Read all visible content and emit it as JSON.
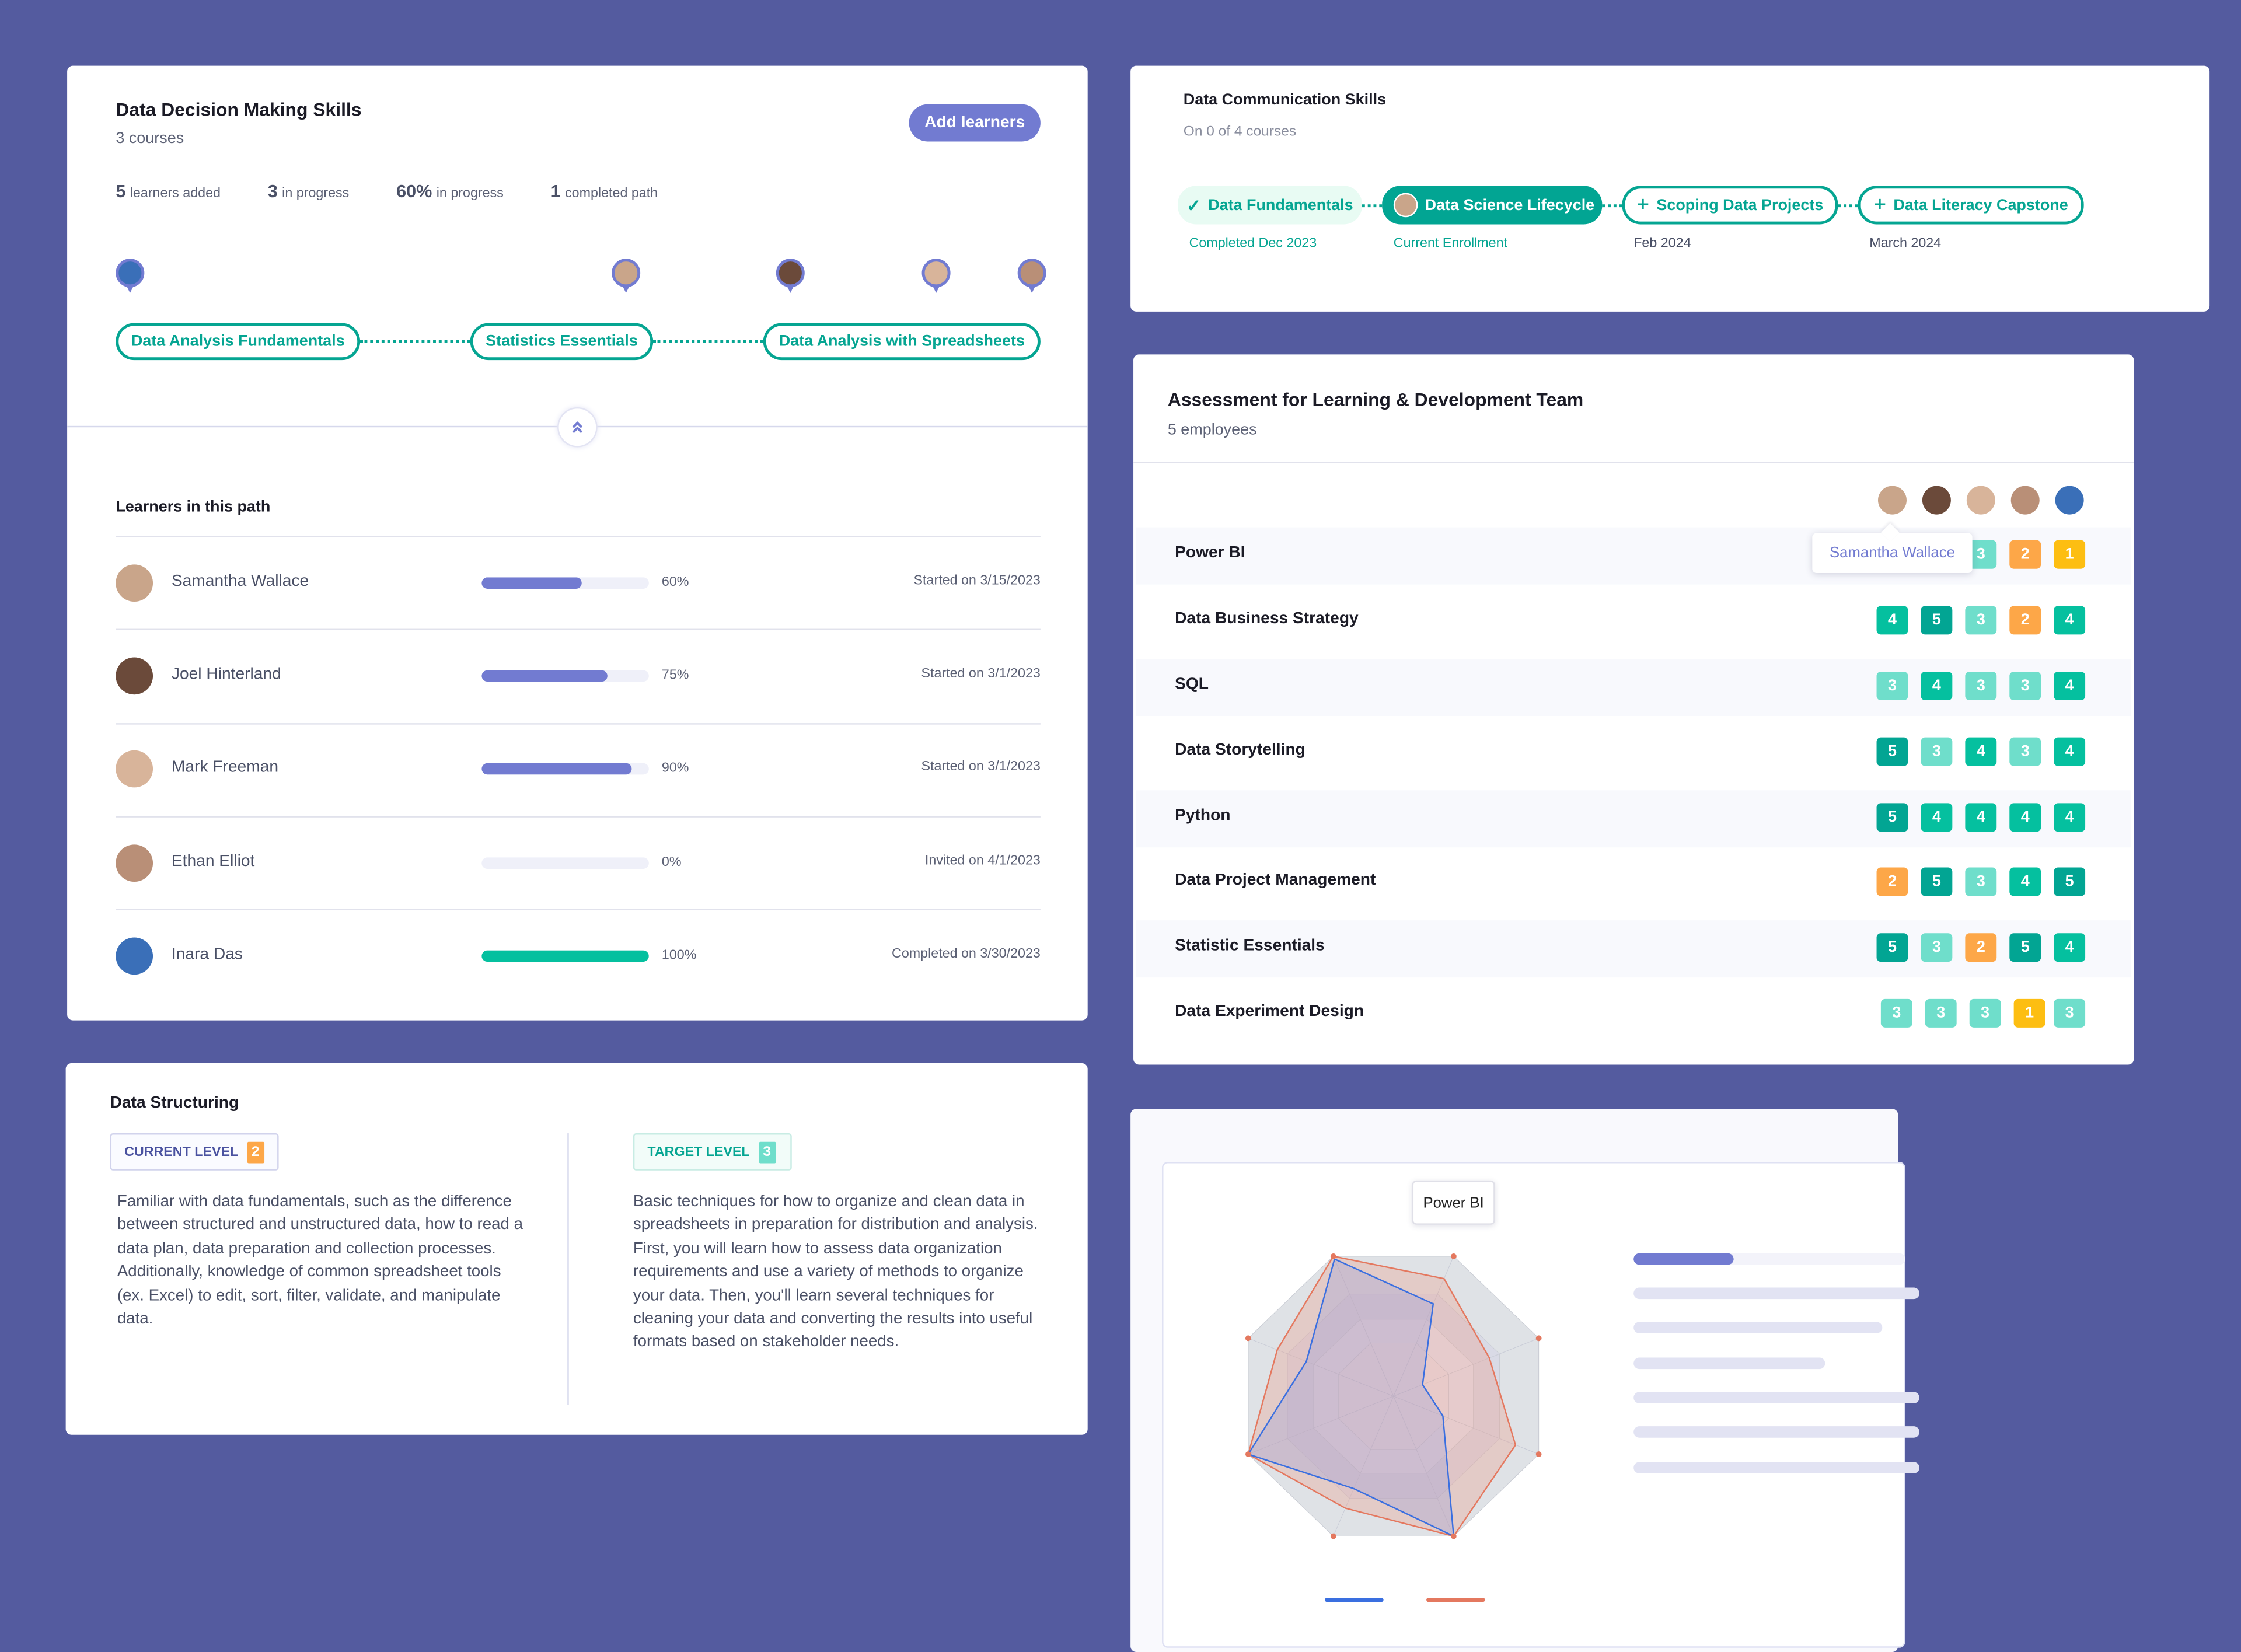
{
  "colors": {
    "background": "#545b9f",
    "accent": "#727bd1",
    "teal": "#05a592",
    "level5": "#02a593",
    "level4": "#05c09f",
    "level3": "#6fdecb",
    "level2": "#fda748",
    "level1": "#fdbe12"
  },
  "path_card": {
    "title": "Data Decision Making Skills",
    "subtitle": "3 courses",
    "add_button": "Add learners",
    "stats": [
      {
        "num": "5",
        "label": "learners added"
      },
      {
        "num": "3",
        "label": "in progress"
      },
      {
        "num": "60%",
        "label": "in progress"
      },
      {
        "num": "1",
        "label": "completed path"
      }
    ],
    "courses": [
      "Data Analysis Fundamentals",
      "Statistics Essentials",
      "Data Analysis with Spreadsheets"
    ],
    "collapse_icon": "chevrons-up-icon",
    "learners_heading": "Learners in this path",
    "learners": [
      {
        "name": "Samantha Wallace",
        "progress": 60,
        "pct": "60%",
        "status": "Started on 3/15/2023"
      },
      {
        "name": "Joel Hinterland",
        "progress": 75,
        "pct": "75%",
        "status": "Started on 3/1/2023"
      },
      {
        "name": "Mark Freeman",
        "progress": 90,
        "pct": "90%",
        "status": "Started on 3/1/2023"
      },
      {
        "name": "Ethan Elliot",
        "progress": 0,
        "pct": "0%",
        "status": "Invited on 4/1/2023"
      },
      {
        "name": "Inara Das",
        "progress": 100,
        "pct": "100%",
        "status": "Completed on 3/30/2023"
      }
    ]
  },
  "comm_card": {
    "title": "Data Communication Skills",
    "subtitle": "On 0 of 4 courses",
    "steps": [
      {
        "label": "Data Fundamentals",
        "caption": "Completed Dec 2023",
        "state": "completed",
        "icon": "check-icon"
      },
      {
        "label": "Data Science Lifecycle",
        "caption": "Current Enrollment",
        "state": "current",
        "icon": "avatar"
      },
      {
        "label": "Scoping Data Projects",
        "caption": "Feb 2024",
        "state": "upcoming",
        "icon": "plus-icon"
      },
      {
        "label": "Data Literacy Capstone",
        "caption": "March 2024",
        "state": "upcoming",
        "icon": "plus-icon"
      }
    ]
  },
  "assessment": {
    "title": "Assessment for Learning & Development Team",
    "subtitle": "5 employees",
    "tooltip": "Samantha Wallace",
    "employees": [
      "Samantha Wallace",
      "Joel Hinterland",
      "Mark Freeman",
      "Ethan Elliot",
      "Inara Das"
    ],
    "rows": [
      {
        "skill": "Power BI",
        "scores": [
          null,
          null,
          3,
          2,
          1
        ]
      },
      {
        "skill": "Data Business Strategy",
        "scores": [
          4,
          5,
          3,
          2,
          4
        ]
      },
      {
        "skill": "SQL",
        "scores": [
          3,
          4,
          3,
          3,
          4
        ]
      },
      {
        "skill": "Data Storytelling",
        "scores": [
          5,
          3,
          4,
          3,
          4
        ]
      },
      {
        "skill": "Python",
        "scores": [
          5,
          4,
          4,
          4,
          4
        ]
      },
      {
        "skill": "Data Project Management",
        "scores": [
          2,
          5,
          3,
          4,
          5
        ]
      },
      {
        "skill": "Statistic Essentials",
        "scores": [
          5,
          3,
          2,
          5,
          4
        ]
      },
      {
        "skill": "Data Experiment Design",
        "scores": [
          3,
          3,
          3,
          1,
          3
        ]
      }
    ]
  },
  "structuring": {
    "title": "Data Structuring",
    "current_label": "CURRENT LEVEL",
    "current_level": "2",
    "target_label": "TARGET LEVEL",
    "target_level": "3",
    "current_text": "Familiar with data fundamentals, such as the difference between structured and unstructured data, how to read a data plan, data preparation and collection processes. Additionally, knowledge of common spreadsheet tools (ex. Excel) to edit, sort, filter, validate, and manipulate data.",
    "target_text": "Basic techniques for how to organize and clean data in spreadsheets in preparation for distribution and analysis. First, you will learn how to assess data organization requirements and use a variety of methods to organize your data. Then, you'll learn several techniques for cleaning your data and converting the results into useful formats based on stakeholder needs."
  },
  "chart_data": {
    "type": "radar",
    "tooltip": "Power BI",
    "scale_max": 5,
    "series": [
      {
        "color": "#3a6fe0",
        "values": [
          3.3,
          1,
          1.7,
          5,
          3.3,
          5,
          3,
          4.9
        ]
      },
      {
        "color": "#e4785f",
        "values": [
          4.2,
          3.3,
          4.2,
          5,
          4,
          5,
          4,
          5
        ]
      }
    ],
    "skeleton_bars": [
      0.35,
      1,
      0.87,
      0.67,
      1,
      1,
      1
    ]
  }
}
